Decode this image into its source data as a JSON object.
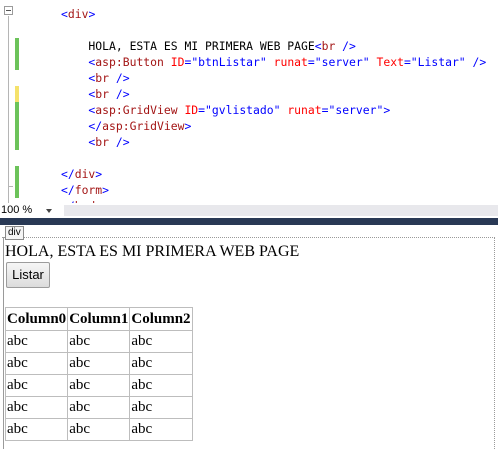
{
  "editor": {
    "lines": [
      [
        {
          "t": "tag",
          "v": "<"
        },
        {
          "t": "el",
          "v": "div"
        },
        {
          "t": "tag",
          "v": ">"
        }
      ],
      [],
      [
        {
          "t": "txt",
          "v": "    HOLA, ESTA ES MI PRIMERA WEB PAGE"
        },
        {
          "t": "tag",
          "v": "<"
        },
        {
          "t": "el",
          "v": "br"
        },
        {
          "t": "tag",
          "v": " />"
        }
      ],
      [
        {
          "t": "tag",
          "v": "    <"
        },
        {
          "t": "el",
          "v": "asp:Button"
        },
        {
          "t": "at",
          "v": " ID"
        },
        {
          "t": "tag",
          "v": "="
        },
        {
          "t": "val",
          "v": "\"btnListar\""
        },
        {
          "t": "at",
          "v": " runat"
        },
        {
          "t": "tag",
          "v": "="
        },
        {
          "t": "val",
          "v": "\"server\""
        },
        {
          "t": "at",
          "v": " Text"
        },
        {
          "t": "tag",
          "v": "="
        },
        {
          "t": "val",
          "v": "\"Listar\""
        },
        {
          "t": "tag",
          "v": " />"
        }
      ],
      [
        {
          "t": "tag",
          "v": "    <"
        },
        {
          "t": "el",
          "v": "br"
        },
        {
          "t": "tag",
          "v": " />"
        }
      ],
      [
        {
          "t": "tag",
          "v": "    <"
        },
        {
          "t": "el",
          "v": "br"
        },
        {
          "t": "tag",
          "v": " />"
        }
      ],
      [
        {
          "t": "tag",
          "v": "    <"
        },
        {
          "t": "el",
          "v": "asp:GridView"
        },
        {
          "t": "at",
          "v": " ID"
        },
        {
          "t": "tag",
          "v": "="
        },
        {
          "t": "val",
          "v": "\"gvlistado\""
        },
        {
          "t": "at",
          "v": " runat"
        },
        {
          "t": "tag",
          "v": "="
        },
        {
          "t": "val",
          "v": "\"server\""
        },
        {
          "t": "tag",
          "v": ">"
        }
      ],
      [
        {
          "t": "tag",
          "v": "    </"
        },
        {
          "t": "el",
          "v": "asp:GridView"
        },
        {
          "t": "tag",
          "v": ">"
        }
      ],
      [
        {
          "t": "tag",
          "v": "    <"
        },
        {
          "t": "el",
          "v": "br"
        },
        {
          "t": "tag",
          "v": " />"
        }
      ],
      [],
      [
        {
          "t": "tag",
          "v": "</"
        },
        {
          "t": "el",
          "v": "div"
        },
        {
          "t": "tag",
          "v": ">"
        }
      ],
      [
        {
          "t": "tag",
          "v": "</"
        },
        {
          "t": "el",
          "v": "form"
        },
        {
          "t": "tag",
          "v": ">"
        }
      ],
      [
        {
          "t": "tag",
          "v": "</"
        },
        {
          "t": "el",
          "v": "body"
        },
        {
          "t": "tag",
          "v": ">"
        }
      ]
    ],
    "change_markers": [
      {
        "color": "#6cc35a",
        "line_from": 2,
        "line_to": 3
      },
      {
        "color": "#f5e26b",
        "line_from": 5,
        "line_to": 5
      },
      {
        "color": "#6cc35a",
        "line_from": 6,
        "line_to": 8
      },
      {
        "color": "#6cc35a",
        "line_from": 10,
        "line_to": 11
      }
    ]
  },
  "zoom": {
    "level": "100 %"
  },
  "colors": {
    "tag": "#0000ff",
    "element": "#a31515",
    "attribute": "#ff0000",
    "value": "#0000ff",
    "splitter": "#293955",
    "saved_marker": "#6cc35a",
    "unsaved_marker": "#f5e26b"
  },
  "design": {
    "container_tag": "div",
    "heading": "HOLA, ESTA ES MI PRIMERA WEB PAGE",
    "button_label": "Listar",
    "grid": {
      "columns": [
        "Column0",
        "Column1",
        "Column2"
      ],
      "rows": [
        [
          "abc",
          "abc",
          "abc"
        ],
        [
          "abc",
          "abc",
          "abc"
        ],
        [
          "abc",
          "abc",
          "abc"
        ],
        [
          "abc",
          "abc",
          "abc"
        ],
        [
          "abc",
          "abc",
          "abc"
        ]
      ]
    }
  }
}
